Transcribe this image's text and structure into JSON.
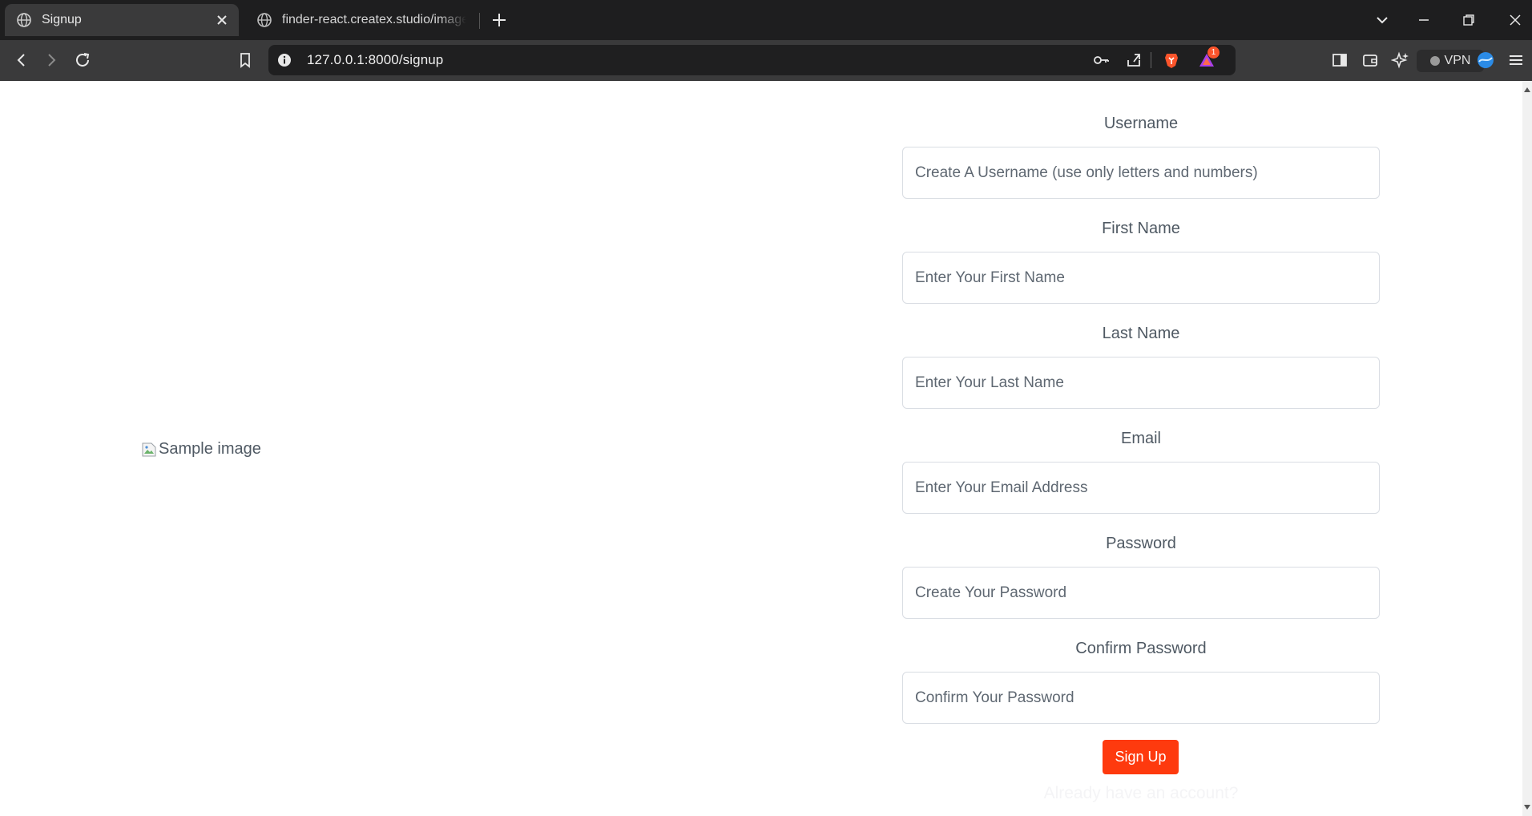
{
  "browser": {
    "tabs": [
      {
        "title": "Signup",
        "active": true
      },
      {
        "title": "finder-react.createx.studio/images/s",
        "active": false
      }
    ],
    "url": "127.0.0.1:8000/signup",
    "vpn_label": "VPN",
    "notification_count": "1"
  },
  "page": {
    "image_alt": "Sample image",
    "form": {
      "username": {
        "label": "Username",
        "placeholder": "Create A Username (use only letters and numbers)"
      },
      "first_name": {
        "label": "First Name",
        "placeholder": "Enter Your First Name"
      },
      "last_name": {
        "label": "Last Name",
        "placeholder": "Enter Your Last Name"
      },
      "email": {
        "label": "Email",
        "placeholder": "Enter Your Email Address"
      },
      "password": {
        "label": "Password",
        "placeholder": "Create Your Password"
      },
      "confirm_password": {
        "label": "Confirm Password",
        "placeholder": "Confirm Your Password"
      },
      "submit_label": "Sign Up",
      "login_prompt": "Already have an account?"
    }
  },
  "colors": {
    "accent": "#fe3a0e",
    "label_text": "#4f5963",
    "chrome_dark": "#1e1e1f",
    "chrome_toolbar": "#3a3a3b"
  }
}
